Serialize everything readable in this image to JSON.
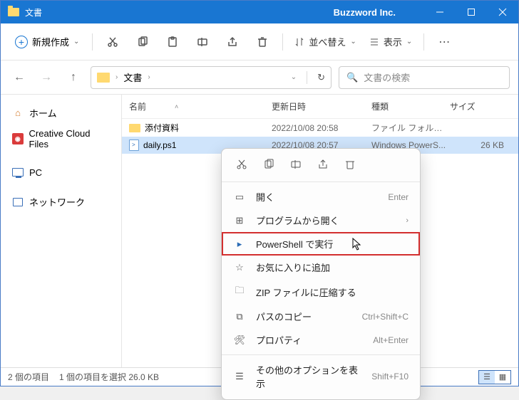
{
  "titlebar": {
    "title": "文書",
    "brand": "Buzzword Inc."
  },
  "toolbar": {
    "new_label": "新規作成",
    "sort_label": "並べ替え",
    "view_label": "表示"
  },
  "breadcrumb": {
    "current": "文書"
  },
  "search": {
    "placeholder": "文書の検索"
  },
  "sidebar": {
    "items": [
      {
        "label": "ホーム"
      },
      {
        "label": "Creative Cloud Files"
      },
      {
        "label": "PC"
      },
      {
        "label": "ネットワーク"
      }
    ]
  },
  "columns": {
    "name": "名前",
    "date": "更新日時",
    "type": "種類",
    "size": "サイズ"
  },
  "rows": [
    {
      "name": "添付資料",
      "date": "2022/10/08 20:58",
      "type": "ファイル フォルダー",
      "size": ""
    },
    {
      "name": "daily.ps1",
      "date": "2022/10/08 20:57",
      "type": "Windows PowerS...",
      "size": "26 KB"
    }
  ],
  "status": {
    "count": "2 個の項目",
    "selected": "1 個の項目を選択 26.0 KB"
  },
  "ctx": {
    "open": "開く",
    "open_accel": "Enter",
    "open_with": "プログラムから開く",
    "run_ps": "PowerShell で実行",
    "favorite": "お気に入りに追加",
    "zip": "ZIP ファイルに圧縮する",
    "copy_path": "パスのコピー",
    "copy_path_accel": "Ctrl+Shift+C",
    "properties": "プロパティ",
    "properties_accel": "Alt+Enter",
    "more": "その他のオプションを表示",
    "more_accel": "Shift+F10"
  }
}
